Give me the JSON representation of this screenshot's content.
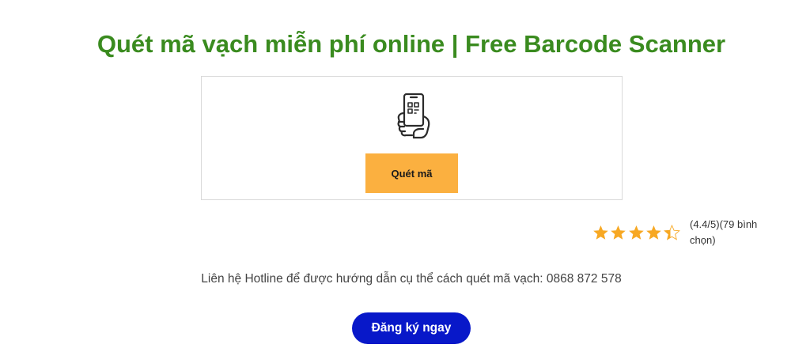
{
  "title": "Quét mã vạch miễn phí online | Free Barcode Scanner",
  "scanner": {
    "icon": "phone-scan-icon",
    "button_label": "Quét mã"
  },
  "rating": {
    "score": 4.4,
    "max": 5,
    "text": "(4.4/5)(79 bình chọn)"
  },
  "hotline": {
    "text": "Liên hệ Hotline để được hướng dẫn cụ thể cách quét mã vạch: 0868 872 578"
  },
  "register": {
    "label": "Đăng ký ngay"
  },
  "colors": {
    "title": "#3a8b1f",
    "scan_button": "#fbb040",
    "star": "#f7a823",
    "register_button": "#0818c9"
  }
}
